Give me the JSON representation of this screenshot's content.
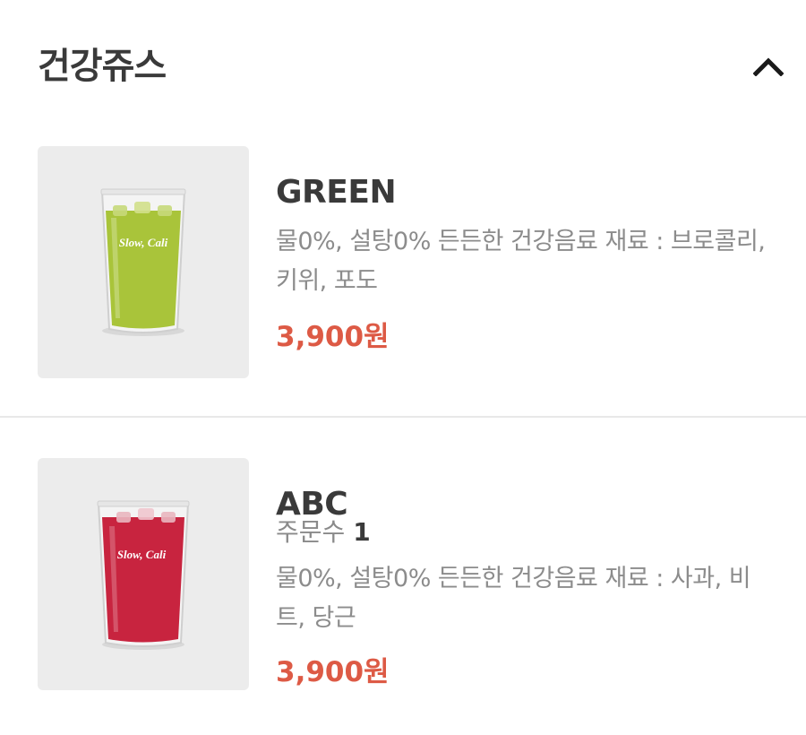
{
  "section": {
    "title": "건강쥬스",
    "toggle_icon": "chevron-up-icon"
  },
  "items": [
    {
      "name": "GREEN",
      "description": "물0%, 설탕0% 든든한 건강음료 재료 : 브로콜리, 키위, 포도",
      "price": "3,900원",
      "image_label": "Slow Cali",
      "drink_color": "#a9c43a"
    },
    {
      "name": "ABC",
      "order_count_label": "주문수",
      "order_count": "1",
      "description": "물0%, 설탕0% 든든한 건강음료 재료 : 사과, 비트, 당근",
      "price": "3,900원",
      "image_label": "Slow Cali",
      "drink_color": "#c8243f"
    }
  ],
  "colors": {
    "price": "#dd5a45",
    "title": "#3a3a3a",
    "muted": "#8c8c8c",
    "thumb_bg": "#ececec"
  }
}
